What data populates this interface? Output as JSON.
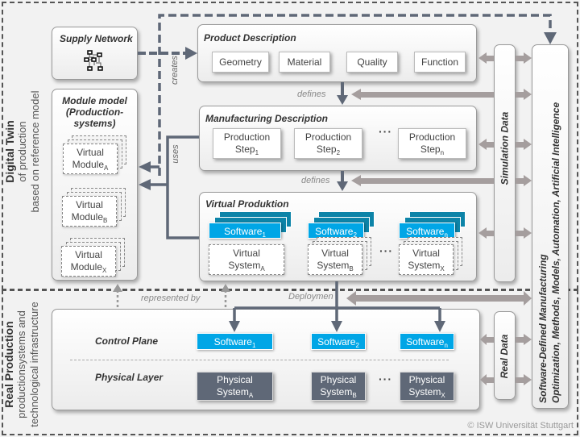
{
  "digital_twin": {
    "title": "Digital Twin",
    "subtitle_line1": "of production",
    "subtitle_line2": "based on reference model"
  },
  "real_production": {
    "title": "Real Production",
    "subtitle_line1": "productionsystems and",
    "subtitle_line2": "technological infrastructure"
  },
  "supply_network": {
    "title": "Supply Network",
    "icon": "network-graph-icon"
  },
  "module_model": {
    "title_line1": "Module model",
    "title_line2": "(Production-",
    "title_line3": "systems)",
    "modules": [
      {
        "label": "Virtual",
        "base": "Module",
        "sub": "A"
      },
      {
        "label": "Virtual",
        "base": "Module",
        "sub": "B"
      },
      {
        "label": "Virtual",
        "base": "Module",
        "sub": "X"
      }
    ]
  },
  "product_description": {
    "title": "Product Description",
    "items": [
      "Geometry",
      "Material",
      "Quality",
      "Function"
    ]
  },
  "manufacturing_description": {
    "title": "Manufacturing Description",
    "steps": [
      {
        "label": "Production",
        "base": "Step",
        "sub": "1"
      },
      {
        "label": "Production",
        "base": "Step",
        "sub": "2"
      },
      {
        "label": "Production",
        "base": "Step",
        "sub": "n"
      }
    ],
    "ellipsis": "···"
  },
  "virtual_production": {
    "title": "Virtual Produktion",
    "software": [
      {
        "base": "Software",
        "sub": "1"
      },
      {
        "base": "Software",
        "sub": "2"
      },
      {
        "base": "Software",
        "sub": "n"
      }
    ],
    "systems": [
      {
        "label": "Virtual",
        "base": "System",
        "sub": "A"
      },
      {
        "label": "Virtual",
        "base": "System",
        "sub": "B"
      },
      {
        "label": "Virtual",
        "base": "System",
        "sub": "X"
      }
    ],
    "ellipsis": "···"
  },
  "control_plane": {
    "title": "Control Plane",
    "software": [
      {
        "base": "Software",
        "sub": "1"
      },
      {
        "base": "Software",
        "sub": "2"
      },
      {
        "base": "Software",
        "sub": "n"
      }
    ]
  },
  "physical_layer": {
    "title": "Physical Layer",
    "systems": [
      {
        "label": "Physical",
        "base": "System",
        "sub": "A"
      },
      {
        "label": "Physical",
        "base": "System",
        "sub": "B"
      },
      {
        "label": "Physical",
        "base": "System",
        "sub": "X"
      }
    ],
    "ellipsis": "···"
  },
  "edge_labels": {
    "creates": "creates",
    "defines_1": "defines",
    "defines_2": "defines",
    "uses": "uses",
    "represented_by": "represented by",
    "deployment": "Deploymen"
  },
  "simulation_data": "Simulation Data",
  "real_data": "Real Data",
  "sdm": {
    "line1": "Software-Defined Manufacturing",
    "line2": "Optimization, Methods, Models, Automation, Artificial Intelligence"
  },
  "copyright": "© ISW Universität Stuttgart",
  "colors": {
    "software_blue": "#00a6e6",
    "physical_gray": "#5f6877",
    "arrow_dark": "#5f6877",
    "arrow_light": "#a59e9e"
  }
}
